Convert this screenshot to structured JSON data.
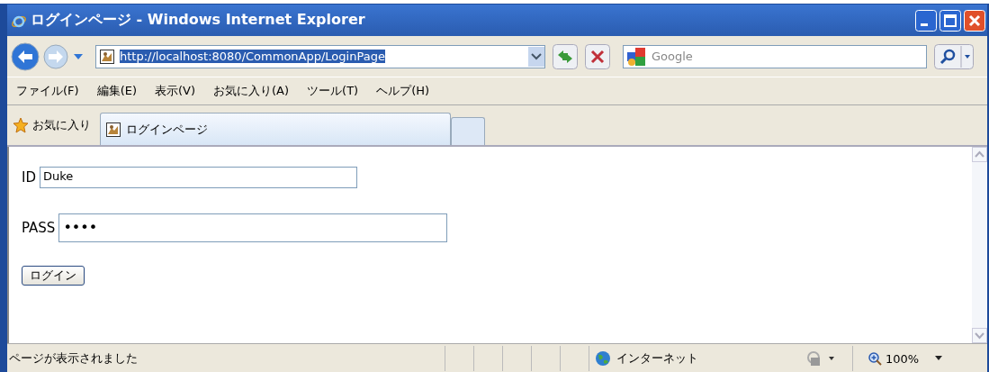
{
  "window": {
    "title": "ログインページ - Windows Internet Explorer"
  },
  "address": {
    "url": "http://localhost:8080/CommonApp/LoginPage",
    "selected": true
  },
  "search": {
    "placeholder": "Google"
  },
  "menu": [
    "ファイル(F)",
    "編集(E)",
    "表示(V)",
    "お気に入り(A)",
    "ツール(T)",
    "ヘルプ(H)"
  ],
  "favorites": {
    "label": "お気に入り"
  },
  "tabs": [
    {
      "label": "ログインページ",
      "selected": true
    }
  ],
  "form": {
    "fields": [
      {
        "label": "ID",
        "value": "Duke",
        "kind": "text"
      },
      {
        "label": "PASS",
        "value": "••••",
        "kind": "password"
      }
    ],
    "button": "ログイン"
  },
  "status_bar": {
    "text": "ページが表示されました",
    "zone": "インターネット",
    "zoom": "100%"
  }
}
